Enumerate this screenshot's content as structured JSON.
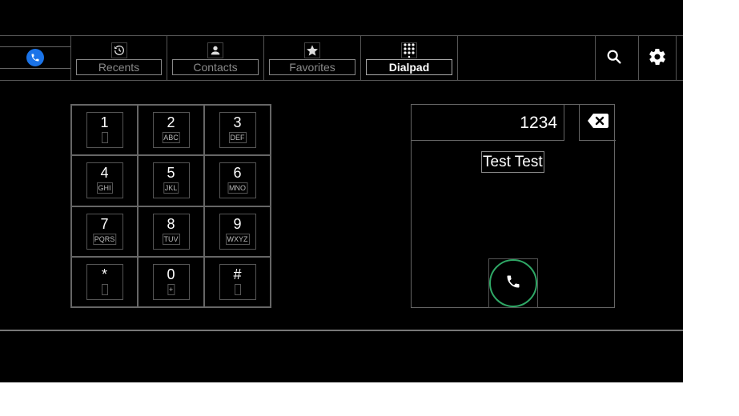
{
  "colors": {
    "background": "#000000",
    "accent": "#1a73e8",
    "call_ring": "#2fa866",
    "text": "#ffffff",
    "muted_text": "#8a8a8a"
  },
  "app": {
    "icon": "phone-icon"
  },
  "tabs": [
    {
      "label": "Recents",
      "icon": "history-icon",
      "active": false
    },
    {
      "label": "Contacts",
      "icon": "contact-icon",
      "active": false
    },
    {
      "label": "Favorites",
      "icon": "star-icon",
      "active": false
    },
    {
      "label": "Dialpad",
      "icon": "dialpad-icon",
      "active": true
    }
  ],
  "toolbar": {
    "search_icon": "search-icon",
    "settings_icon": "gear-icon"
  },
  "keypad": {
    "keys": [
      {
        "digit": "1",
        "letters": ""
      },
      {
        "digit": "2",
        "letters": "ABC"
      },
      {
        "digit": "3",
        "letters": "DEF"
      },
      {
        "digit": "4",
        "letters": "GHI"
      },
      {
        "digit": "5",
        "letters": "JKL"
      },
      {
        "digit": "6",
        "letters": "MNO"
      },
      {
        "digit": "7",
        "letters": "PQRS"
      },
      {
        "digit": "8",
        "letters": "TUV"
      },
      {
        "digit": "9",
        "letters": "WXYZ"
      },
      {
        "digit": "*",
        "letters": ""
      },
      {
        "digit": "0",
        "letters": "+"
      },
      {
        "digit": "#",
        "letters": ""
      }
    ]
  },
  "dial": {
    "number": "1234",
    "contact_match": "Test Test",
    "backspace_icon": "backspace-icon",
    "call_icon": "phone-icon"
  }
}
